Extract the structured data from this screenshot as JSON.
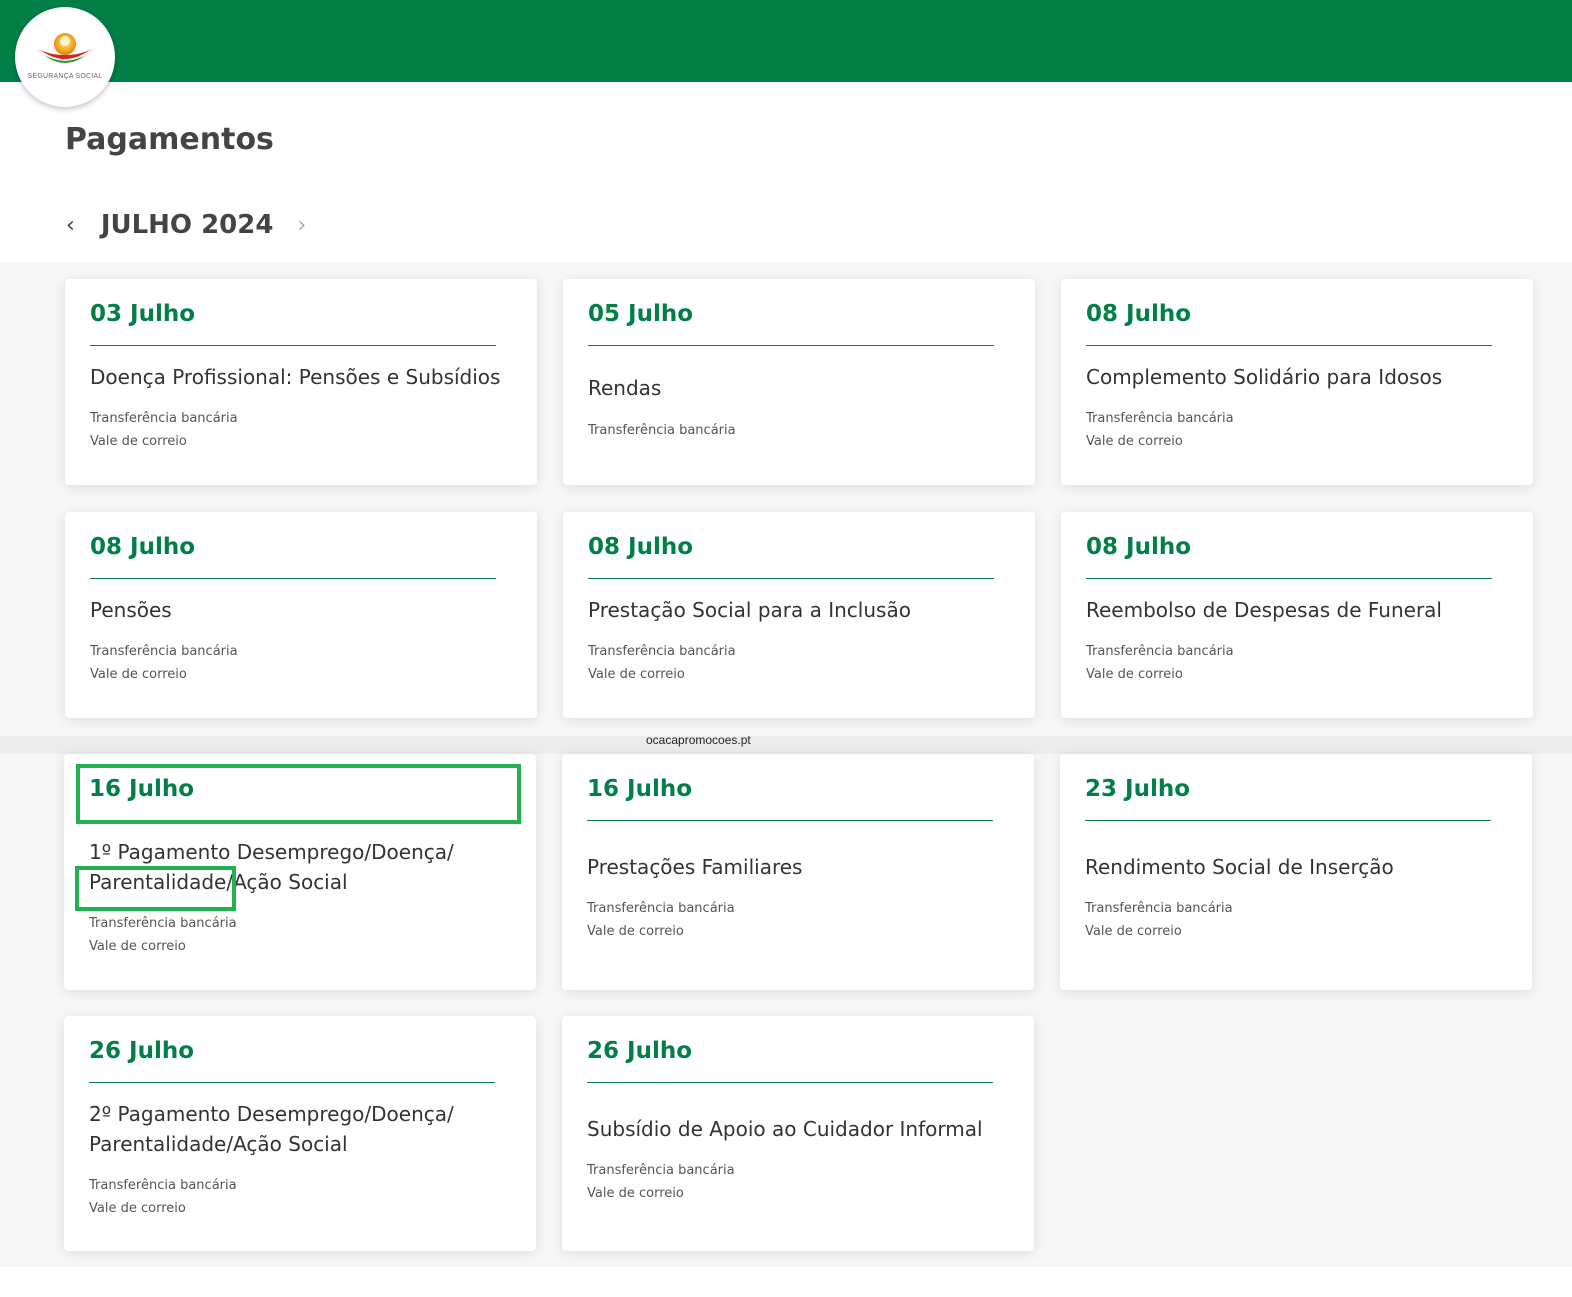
{
  "header": {
    "brand_color": "#017F46",
    "logo_text": "SEGURANÇA SOCIAL"
  },
  "page_title": "Pagamentos",
  "month_nav": {
    "label": "JULHO 2024",
    "prev_icon": "chevron-left-icon",
    "next_icon": "chevron-right-icon"
  },
  "cards": [
    {
      "date": "03 Julho",
      "title": "Doença Profissional: Pensões e Subsídios",
      "methods": [
        "Transferência bancária",
        "Vale de correio"
      ]
    },
    {
      "date": "05 Julho",
      "title": "Rendas",
      "methods": [
        "Transferência bancária"
      ]
    },
    {
      "date": "08 Julho",
      "title": "Complemento Solidário para Idosos",
      "methods": [
        "Transferência bancária",
        "Vale de correio"
      ]
    },
    {
      "date": "08 Julho",
      "title": "Pensões",
      "methods": [
        "Transferência bancária",
        "Vale de correio"
      ]
    },
    {
      "date": "08 Julho",
      "title": "Prestação Social para a Inclusão",
      "methods": [
        "Transferência bancária",
        "Vale de correio"
      ]
    },
    {
      "date": "08 Julho",
      "title": "Reembolso de Despesas de Funeral",
      "methods": [
        "Transferência bancária",
        "Vale de correio"
      ]
    },
    {
      "date": "16 Julho",
      "title": "1º Pagamento Desemprego/Doença/ Parentalidade/Ação Social",
      "methods": [
        "Transferência bancária",
        "Vale de correio"
      ]
    },
    {
      "date": "16 Julho",
      "title": "Prestações Familiares",
      "methods": [
        "Transferência bancária",
        "Vale de correio"
      ]
    },
    {
      "date": "23 Julho",
      "title": "Rendimento Social de Inserção",
      "methods": [
        "Transferência bancária",
        "Vale de correio"
      ]
    },
    {
      "date": "26 Julho",
      "title": "2º Pagamento Desemprego/Doença/ Parentalidade/Ação Social",
      "methods": [
        "Transferência bancária",
        "Vale de correio"
      ]
    },
    {
      "date": "26 Julho",
      "title": "Subsídio de Apoio ao Cuidador Informal",
      "methods": [
        "Transferência bancária",
        "Vale de correio"
      ]
    }
  ],
  "watermark": "ocacapromocoes.pt",
  "highlight_color": "#22b14c"
}
